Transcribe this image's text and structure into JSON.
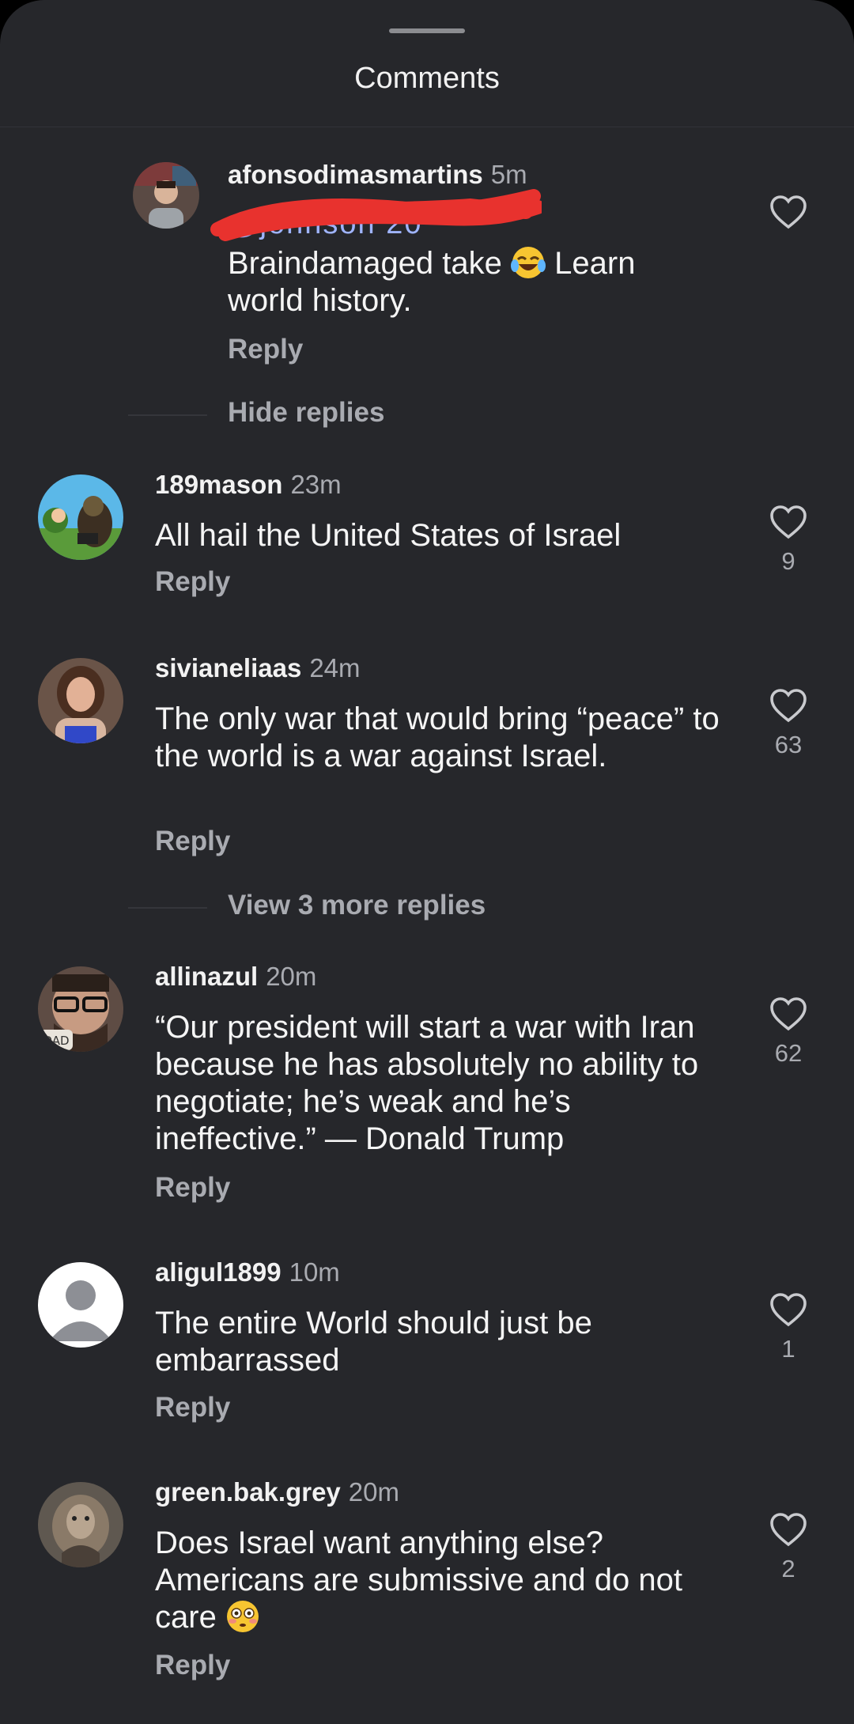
{
  "header": {
    "title": "Comments"
  },
  "comments": [
    {
      "username": "afonsodimasmartins",
      "time": "5m",
      "mention_fragment": "@johnson 20",
      "text_before_emoji": "Braindamaged take ",
      "emoji": "face-with-tears-of-joy",
      "text_after_emoji": " Learn world history.",
      "reply_label": "Reply",
      "likes": null
    },
    {
      "username": "189mason",
      "time": "23m",
      "text": "All hail the United States of Israel",
      "reply_label": "Reply",
      "likes": "9"
    },
    {
      "username": "sivianeliaas",
      "time": "24m",
      "text": "The only war that would bring “peace” to the world is a war against Israel.",
      "reply_label": "Reply",
      "likes": "63"
    },
    {
      "username": "allinazul",
      "time": "20m",
      "text": "“Our president will start a war with Iran because he has absolutely no ability to negotiate; he’s weak and he’s ineffective.” — Donald Trump",
      "reply_label": "Reply",
      "likes": "62"
    },
    {
      "username": "aligul1899",
      "time": "10m",
      "text": "The entire World should just be embarrassed",
      "reply_label": "Reply",
      "likes": "1"
    },
    {
      "username": "green.bak.grey",
      "time": "20m",
      "text_before_emoji": "Does Israel want anything else? Americans are submissive and do not care ",
      "emoji": "flushed-face",
      "reply_label": "Reply",
      "likes": "2"
    }
  ],
  "toggles": {
    "hide_replies": "Hide replies",
    "view_more": "View 3 more replies"
  },
  "avatar_badge_text": "DAD",
  "colors": {
    "background": "#26272b",
    "secondary_text": "#a9abb1",
    "redaction": "#e8322e"
  }
}
